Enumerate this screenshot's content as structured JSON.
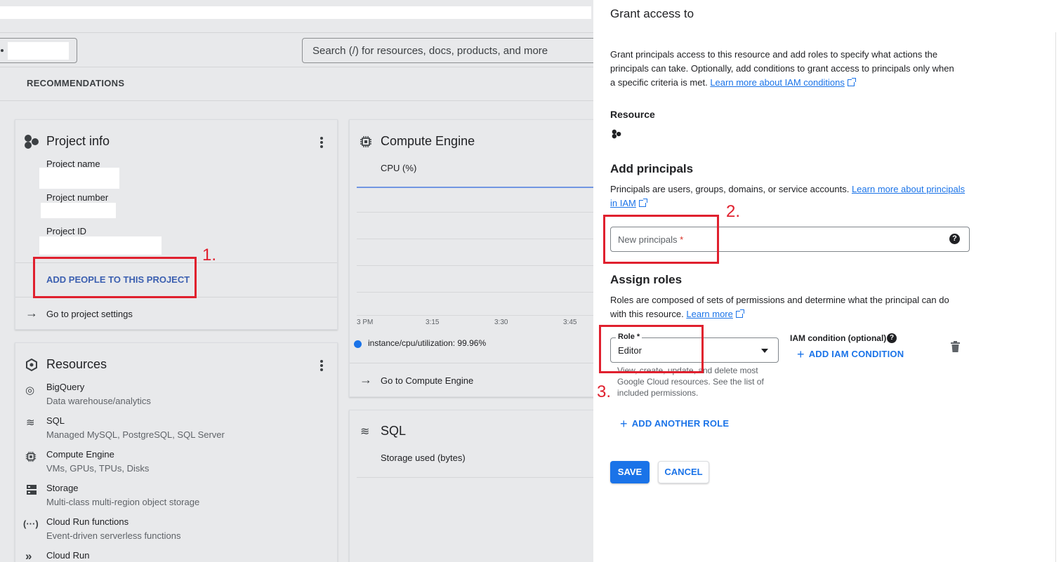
{
  "header": {
    "search_placeholder": "Search (/) for resources, docs, products, and more",
    "tab_recommendations": "RECOMMENDATIONS"
  },
  "project_info": {
    "title": "Project info",
    "name_label": "Project name",
    "number_label": "Project number",
    "id_label": "Project ID",
    "add_people": "ADD PEOPLE TO THIS PROJECT",
    "go_settings": "Go to project settings"
  },
  "compute_engine": {
    "title": "Compute Engine",
    "metric": "CPU (%)",
    "legend": "instance/cpu/utilization:",
    "legend_value": "99.96%",
    "go_link": "Go to Compute Engine",
    "chart_data": {
      "type": "line",
      "x_ticks": [
        "3 PM",
        "3:15",
        "3:30",
        "3:45"
      ],
      "ylabel": "CPU (%)",
      "series": [
        {
          "name": "instance/cpu/utilization",
          "values": [
            99.96,
            99.96,
            99.96,
            99.96
          ]
        }
      ]
    }
  },
  "resources": {
    "title": "Resources",
    "items": [
      {
        "name": "BigQuery",
        "desc": "Data warehouse/analytics"
      },
      {
        "name": "SQL",
        "desc": "Managed MySQL, PostgreSQL, SQL Server"
      },
      {
        "name": "Compute Engine",
        "desc": "VMs, GPUs, TPUs, Disks"
      },
      {
        "name": "Storage",
        "desc": "Multi-class multi-region object storage"
      },
      {
        "name": "Cloud Run functions",
        "desc": "Event-driven serverless functions"
      },
      {
        "name": "Cloud Run",
        "desc": ""
      }
    ]
  },
  "sql_card": {
    "title": "SQL",
    "metric": "Storage used (bytes)"
  },
  "panel": {
    "title": "Grant access to",
    "intro": "Grant principals access to this resource and add roles to specify what actions the principals can take. Optionally, add conditions to grant access to principals only when a specific criteria is met.",
    "intro_link": "Learn more about IAM conditions",
    "resource_heading": "Resource",
    "add_principals_heading": "Add principals",
    "principals_desc": "Principals are users, groups, domains, or service accounts.",
    "principals_link": "Learn more about principals in IAM",
    "new_principals_label": "New principals",
    "required_mark": "*",
    "assign_roles_heading": "Assign roles",
    "roles_desc": "Roles are composed of sets of permissions and determine what the principal can do with this resource.",
    "roles_link": "Learn more",
    "role_label": "Role *",
    "role_value": "Editor",
    "role_desc": "View, create, update, and delete most Google Cloud resources. See the list of included permissions.",
    "iam_condition_label": "IAM condition (optional)",
    "add_iam_condition": "ADD IAM CONDITION",
    "add_another_role": "ADD ANOTHER ROLE",
    "save": "SAVE",
    "cancel": "CANCEL"
  },
  "annotations": [
    "1.",
    "2.",
    "3."
  ],
  "colors": {
    "accent": "#1a73e8",
    "annotation_red": "#e0202e"
  }
}
